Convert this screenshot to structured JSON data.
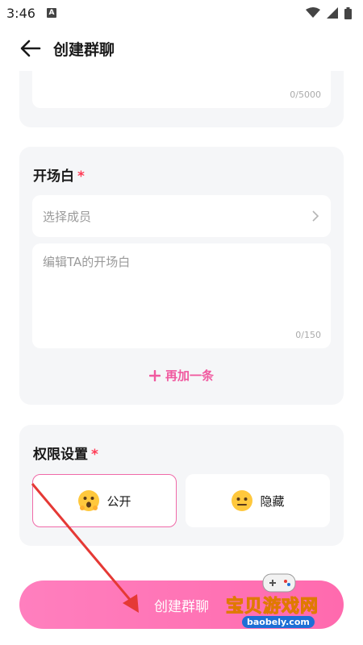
{
  "status_bar": {
    "time": "3:46",
    "badge": "A"
  },
  "app_bar": {
    "title": "创建群聊"
  },
  "top_card": {
    "counter": "0/5000"
  },
  "opener_section": {
    "title": "开场白",
    "required_mark": "*",
    "member_placeholder": "选择成员",
    "opener_placeholder": "编辑TA的开场白",
    "counter": "0/150",
    "add_more_label": "再加一条"
  },
  "permission_section": {
    "title": "权限设置",
    "required_mark": "*",
    "options": [
      {
        "label": "公开",
        "icon": "surprised-face-emoji",
        "selected": true
      },
      {
        "label": "隐藏",
        "icon": "neutral-face-emoji",
        "selected": false
      }
    ]
  },
  "create_button": {
    "label": "创建群聊"
  },
  "watermark": {
    "text": "宝贝游戏网",
    "url": "baobely.com"
  },
  "colors": {
    "accent": "#f0599f",
    "button": "#ff73b4",
    "card_bg": "#f5f6f8",
    "required": "#ff3b55",
    "annotation_arrow": "#e53935"
  }
}
